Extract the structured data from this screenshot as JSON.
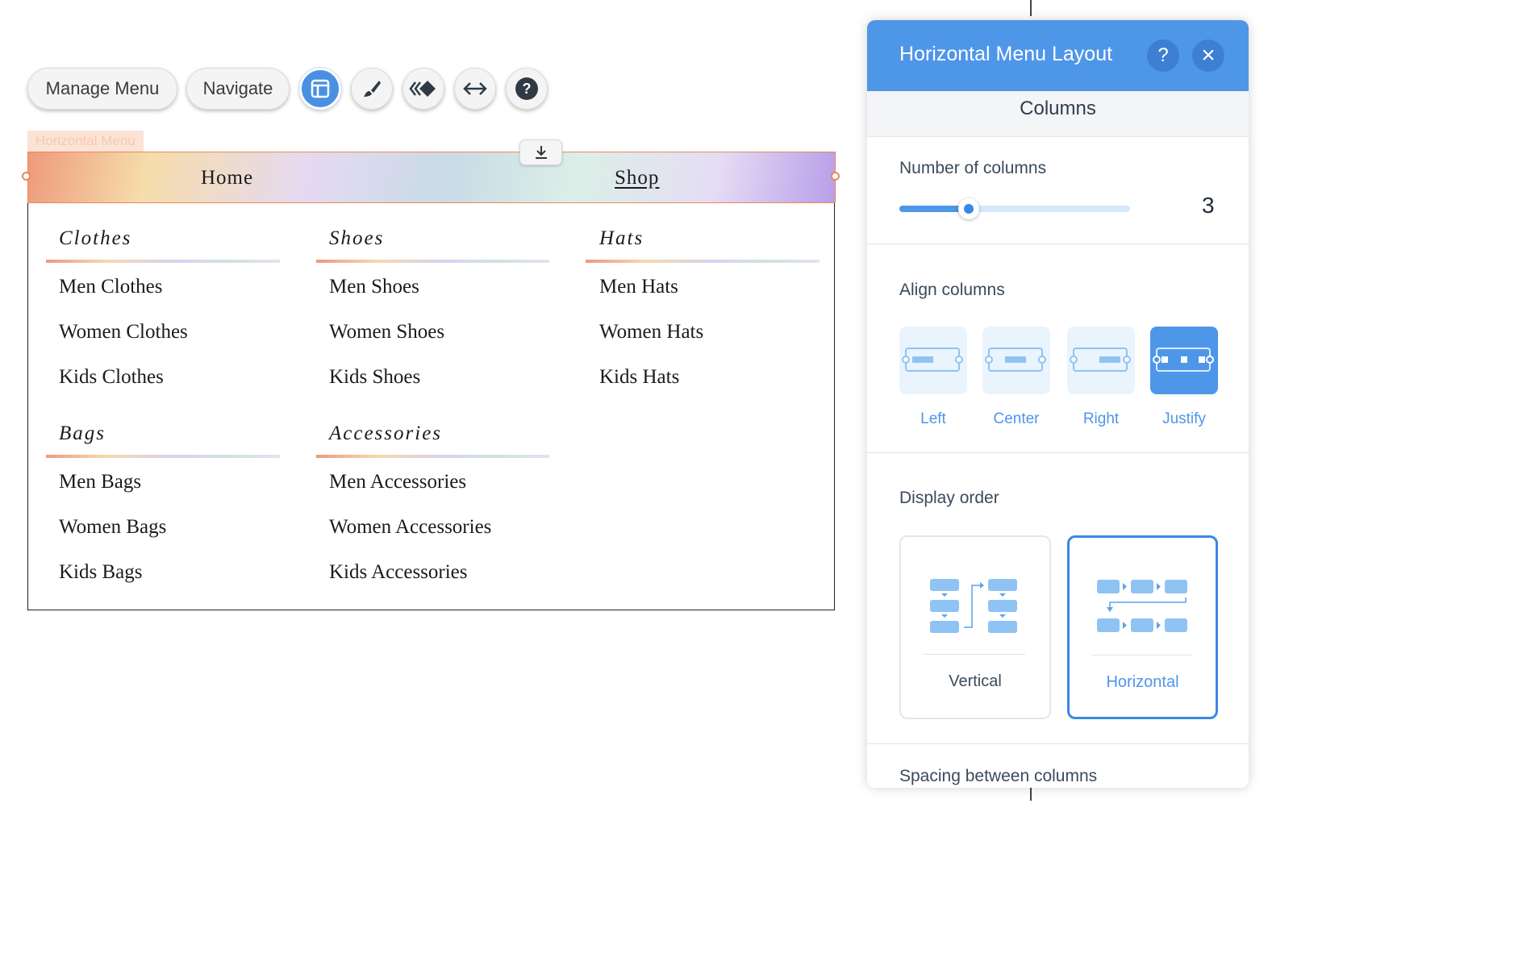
{
  "toolbar": {
    "manage_menu": "Manage Menu",
    "navigate": "Navigate",
    "icons": [
      "layout-icon",
      "brush-icon",
      "animation-icon",
      "stretch-icon",
      "help-icon"
    ]
  },
  "menu": {
    "tag": "Horizontal Menu",
    "items": [
      {
        "label": "Home"
      },
      {
        "label": "Shop"
      }
    ],
    "columns": [
      {
        "heading": "Clothes",
        "items": [
          "Men Clothes",
          "Women Clothes",
          "Kids Clothes"
        ]
      },
      {
        "heading": "Shoes",
        "items": [
          "Men Shoes",
          "Women Shoes",
          "Kids Shoes"
        ]
      },
      {
        "heading": "Hats",
        "items": [
          "Men Hats",
          "Women Hats",
          "Kids Hats"
        ]
      },
      {
        "heading": "Bags",
        "items": [
          "Men Bags",
          "Women Bags",
          "Kids Bags"
        ]
      },
      {
        "heading": "Accessories",
        "items": [
          "Men Accessories",
          "Women Accessories",
          "Kids Accessories"
        ]
      }
    ]
  },
  "panel": {
    "title": "Horizontal Menu Layout",
    "help": "?",
    "close": "×",
    "tab": "Columns",
    "num_columns_label": "Number of columns",
    "num_columns_value": "3",
    "slider_fraction": 0.3,
    "align_label": "Align columns",
    "align_options": [
      "Left",
      "Center",
      "Right",
      "Justify"
    ],
    "align_selected": "Justify",
    "display_order_label": "Display order",
    "order_options": [
      "Vertical",
      "Horizontal"
    ],
    "order_selected": "Horizontal",
    "spacing_label": "Spacing between columns"
  },
  "colors": {
    "accent": "#4e96e8",
    "handle": "#ea8a55"
  }
}
